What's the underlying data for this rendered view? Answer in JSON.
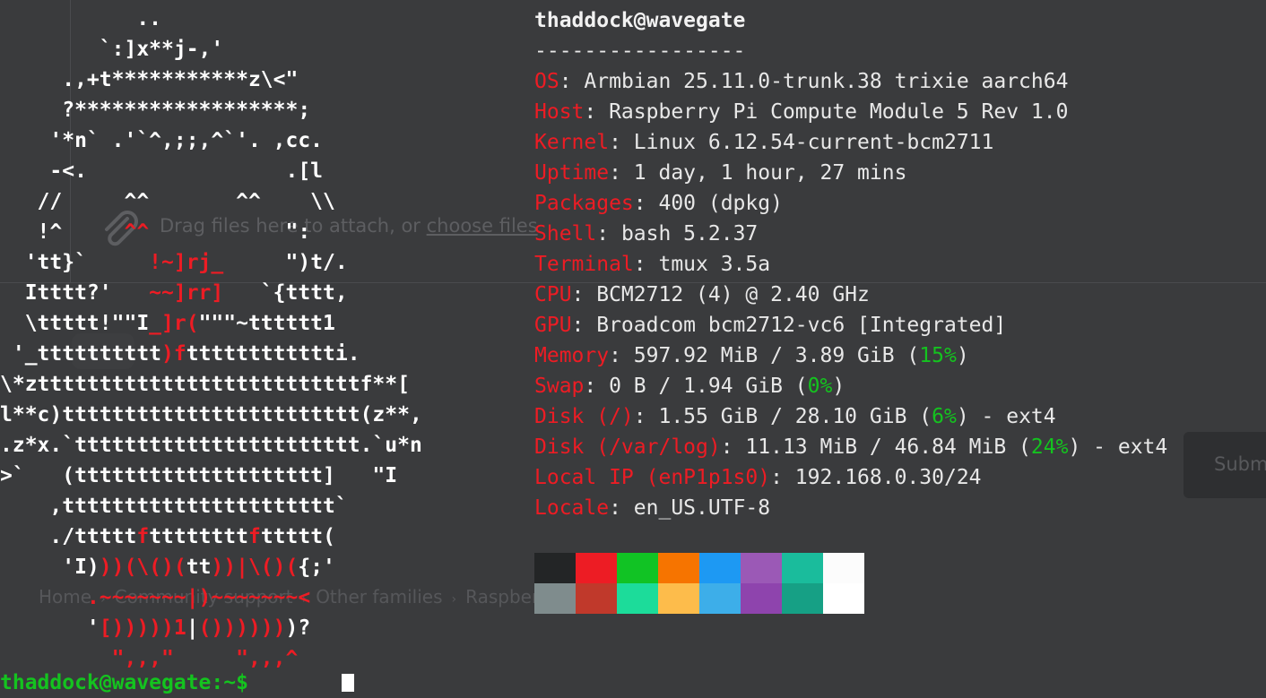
{
  "background_page": {
    "attach_text": "Drag files here to attach, or",
    "attach_link": "choose files",
    "submit_label": "Submit",
    "breadcrumbs": [
      "Home",
      "Community support",
      "Other families",
      "Raspberry Pi"
    ]
  },
  "logo": {
    "lines": [
      [
        {
          "t": "           ..",
          "c": "w"
        }
      ],
      [
        {
          "t": "        `:]x**j-,'",
          "c": "w"
        }
      ],
      [
        {
          "t": "     .,+t***********z\\<\"",
          "c": "w"
        }
      ],
      [
        {
          "t": "     ?******************;",
          "c": "w"
        }
      ],
      [
        {
          "t": "    '*n` .'`^,;;,^`'. ,cc.",
          "c": "w"
        }
      ],
      [
        {
          "t": "    -<.                .[l",
          "c": "w"
        }
      ],
      [
        {
          "t": "   //     ^^       ^^    \\\\",
          "c": "w"
        }
      ],
      [
        {
          "t": "   !^     ",
          "c": "w"
        },
        {
          "t": "^^",
          "c": "r"
        },
        {
          "t": "           \":",
          "c": "w"
        }
      ],
      [
        {
          "t": "  'tt}`     ",
          "c": "w"
        },
        {
          "t": "!~]rj_",
          "c": "r"
        },
        {
          "t": "     \")t/.",
          "c": "w"
        }
      ],
      [
        {
          "t": "  Itttt?'   ",
          "c": "w"
        },
        {
          "t": "~~]rr]",
          "c": "r"
        },
        {
          "t": "   `{tttt,",
          "c": "w"
        }
      ],
      [
        {
          "t": "  \\ttttt!\"\"I",
          "c": "w"
        },
        {
          "t": "_]r(",
          "c": "r"
        },
        {
          "t": "\"\"\"~tttttt1",
          "c": "w"
        }
      ],
      [
        {
          "t": " '_tttttttttt",
          "c": "w"
        },
        {
          "t": ")f",
          "c": "r"
        },
        {
          "t": "tttttttttttti.",
          "c": "w"
        }
      ],
      [
        {
          "t": "\\*zttttttttttttttttttttttttttf**[",
          "c": "w"
        }
      ],
      [
        {
          "t": "l**c)tttttttttttttttttttttttt(z**,",
          "c": "w"
        }
      ],
      [
        {
          "t": ".z*x.`ttttttttttttttttttttttt.`u*n",
          "c": "w"
        }
      ],
      [
        {
          "t": ">`   (tttttttttttttttttttt]   \"I",
          "c": "w"
        }
      ],
      [
        {
          "t": "    ,tttttttttttttttttttttt`",
          "c": "w"
        }
      ],
      [
        {
          "t": "    ./ttttt",
          "c": "w"
        },
        {
          "t": "f",
          "c": "r"
        },
        {
          "t": "tttttttt",
          "c": "w"
        },
        {
          "t": "f",
          "c": "r"
        },
        {
          "t": "ttttt(",
          "c": "w"
        }
      ],
      [
        {
          "t": "     'I)",
          "c": "w"
        },
        {
          "t": "))(\\()(",
          "c": "r"
        },
        {
          "t": "tt",
          "c": "w"
        },
        {
          "t": "))|\\()(",
          "c": "r"
        },
        {
          "t": "{;'",
          "c": "w"
        }
      ],
      [
        {
          "t": "       ",
          "c": "w"
        },
        {
          "t": ".~~~~~~~|)~~~~~~~<",
          "c": "r"
        }
      ],
      [
        {
          "t": "       '",
          "c": "w"
        },
        {
          "t": "[)))))1",
          "c": "r"
        },
        {
          "t": "|",
          "c": "w"
        },
        {
          "t": "())))))",
          "c": "r"
        },
        {
          "t": ")?",
          "c": "w"
        }
      ],
      [
        {
          "t": "         \",,,\"     \",,,^",
          "c": "r"
        }
      ]
    ]
  },
  "info": {
    "title": "thaddock@wavegate",
    "separator": "-----------------",
    "rows": [
      {
        "key": "OS",
        "parts": [
          {
            "t": ": Armbian 25.11.0-trunk.38 trixie aarch64"
          }
        ]
      },
      {
        "key": "Host",
        "parts": [
          {
            "t": ": Raspberry Pi Compute Module 5 Rev 1.0"
          }
        ]
      },
      {
        "key": "Kernel",
        "parts": [
          {
            "t": ": Linux 6.12.54-current-bcm2711"
          }
        ]
      },
      {
        "key": "Uptime",
        "parts": [
          {
            "t": ": 1 day, 1 hour, 27 mins"
          }
        ]
      },
      {
        "key": "Packages",
        "parts": [
          {
            "t": ": 400 (dpkg)"
          }
        ]
      },
      {
        "key": "Shell",
        "parts": [
          {
            "t": ": bash 5.2.37"
          }
        ]
      },
      {
        "key": "Terminal",
        "parts": [
          {
            "t": ": tmux 3.5a"
          }
        ]
      },
      {
        "key": "CPU",
        "parts": [
          {
            "t": ": BCM2712 (4) @ 2.40 GHz"
          }
        ]
      },
      {
        "key": "GPU",
        "parts": [
          {
            "t": ": Broadcom bcm2712-vc6 [Integrated]"
          }
        ]
      },
      {
        "key": "Memory",
        "parts": [
          {
            "t": ": 597.92 MiB / 3.89 GiB ("
          },
          {
            "t": "15%",
            "p": true
          },
          {
            "t": ")"
          }
        ]
      },
      {
        "key": "Swap",
        "parts": [
          {
            "t": ": 0 B / 1.94 GiB ("
          },
          {
            "t": "0%",
            "p": true
          },
          {
            "t": ")"
          }
        ]
      },
      {
        "key": "Disk (/)",
        "parts": [
          {
            "t": ": 1.55 GiB / 28.10 GiB ("
          },
          {
            "t": "6%",
            "p": true
          },
          {
            "t": ") - ext4"
          }
        ]
      },
      {
        "key": "Disk (/var/log)",
        "parts": [
          {
            "t": ": 11.13 MiB / 46.84 MiB ("
          },
          {
            "t": "24%",
            "p": true
          },
          {
            "t": ") - ext4"
          }
        ]
      },
      {
        "key": "Local IP (enP1p1s0)",
        "parts": [
          {
            "t": ": 192.168.0.30/24"
          }
        ]
      },
      {
        "key": "Locale",
        "parts": [
          {
            "t": ": en_US.UTF-8"
          }
        ]
      }
    ],
    "palette_top": [
      "#232526",
      "#ed1c24",
      "#11c324",
      "#f67400",
      "#1d99f3",
      "#9b59b6",
      "#1abc9c",
      "#fcfcfc"
    ],
    "palette_bottom": [
      "#7f8c8d",
      "#c0392b",
      "#1cdc9a",
      "#fdbc4b",
      "#3daee9",
      "#8e44ad",
      "#16a085",
      "#ffffff"
    ]
  },
  "prompt": {
    "text": "thaddock@wavegate:~$ "
  }
}
